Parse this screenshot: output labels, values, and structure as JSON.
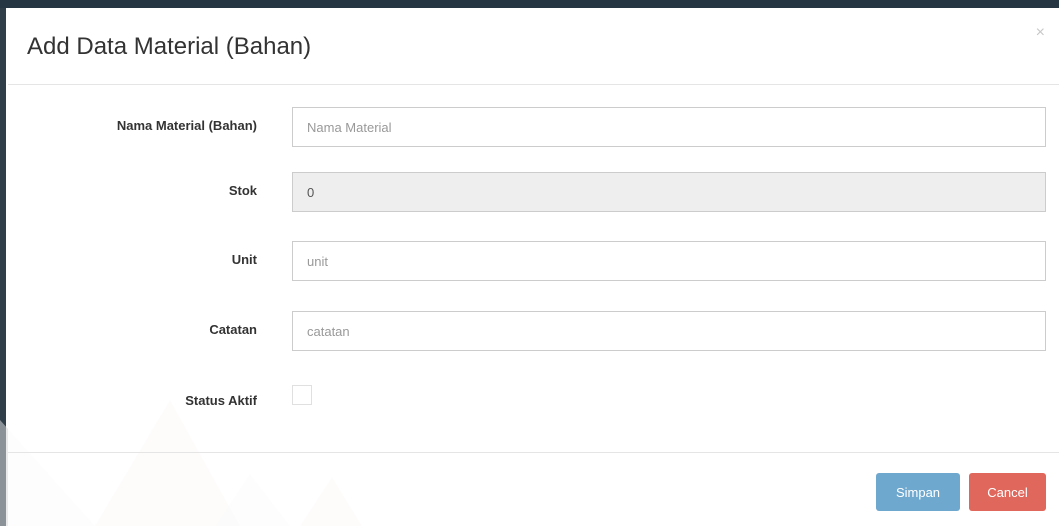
{
  "modal": {
    "title": "Add Data Material (Bahan)",
    "close_symbol": "×"
  },
  "form": {
    "nama_material": {
      "label": "Nama Material (Bahan)",
      "value": "",
      "placeholder": "Nama Material"
    },
    "stok": {
      "label": "Stok",
      "value": "0",
      "readonly": true
    },
    "unit": {
      "label": "Unit",
      "value": "",
      "placeholder": "unit"
    },
    "catatan": {
      "label": "Catatan",
      "value": "",
      "placeholder": "catatan"
    },
    "status_aktif": {
      "label": "Status Aktif",
      "checked": false
    }
  },
  "footer": {
    "save_label": "Simpan",
    "cancel_label": "Cancel"
  },
  "colors": {
    "save_button": "#6fa8cf",
    "cancel_button": "#e0675c",
    "readonly_background": "#eeeeee",
    "background_strip": "#263642"
  }
}
